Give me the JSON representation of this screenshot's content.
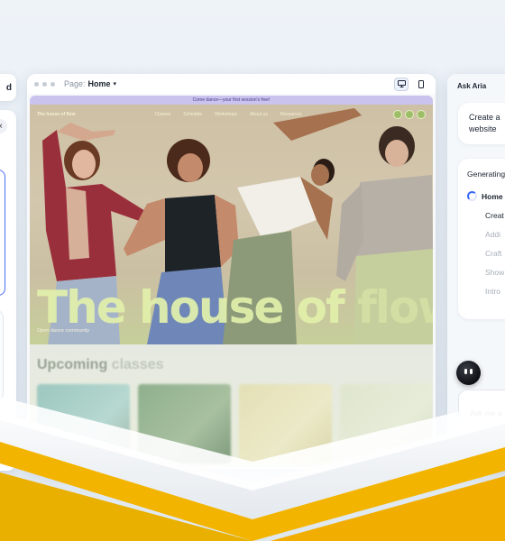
{
  "left_panel": {
    "top_fragment": "d",
    "close_icon": "×",
    "tick": "‹"
  },
  "editor": {
    "page_label": "Page:",
    "page_name": "Home",
    "chevron": "▾",
    "site": {
      "announcement": "Come dance—your first session's free!",
      "brand": "The house of flow",
      "nav": [
        "Classes",
        "Schedule",
        "Workshops",
        "About us",
        "Resources"
      ],
      "hero_title_main": "The house of ",
      "hero_title_faded": "flow",
      "hero_subtitle": "Open dance community",
      "section_title_main": "Upcoming ",
      "section_title_faded": "classes"
    }
  },
  "aria": {
    "title": "Ask Aria",
    "user_message_line1": "Create a",
    "user_message_line2": "website",
    "generating_title": "Generating",
    "steps": {
      "active": "Home",
      "next": "Creat",
      "pending1": "Addi",
      "pending2": "Craft",
      "pending3": "Show",
      "pending4": "Intro"
    },
    "input_placeholder": "Ask me a",
    "add_icon": "+",
    "mention_icon": "@"
  },
  "colors": {
    "accent": "#3a6af5",
    "hero_title": "#e2f0aa",
    "announcement_bg": "#c9c3ee"
  }
}
